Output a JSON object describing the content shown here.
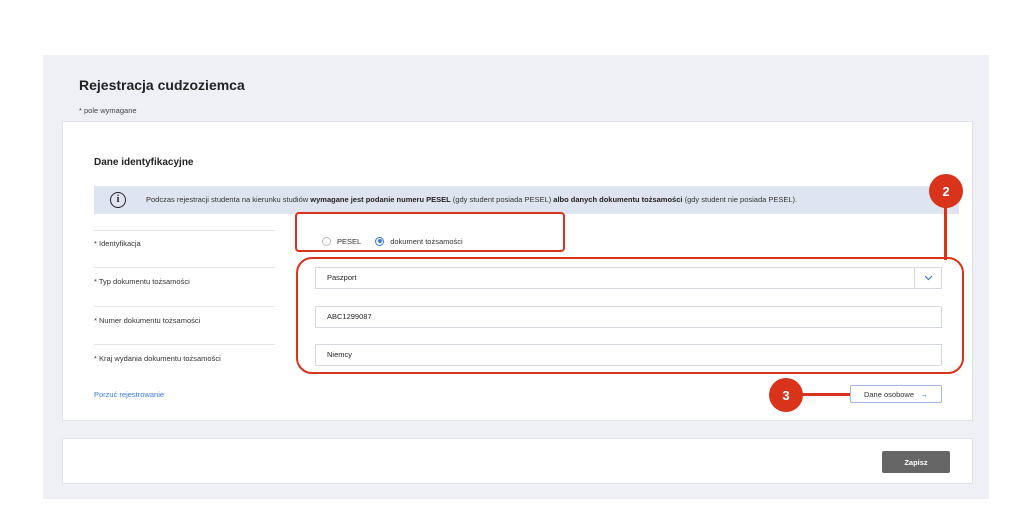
{
  "page": {
    "title": "Rejestracja cudzoziemca",
    "required_note": "* pole wymagane"
  },
  "section": {
    "title": "Dane identyfikacyjne",
    "info": {
      "icon": "info-icon",
      "text_1": "Podczas rejestracji studenta na kierunku studiów ",
      "bold_1": "wymagane jest podanie numeru PESEL",
      "text_2": " (gdy student posiada PESEL) ",
      "bold_2": "albo danych dokumentu tożsamości",
      "text_3": " (gdy student nie posiada PESEL)."
    }
  },
  "form": {
    "identification": {
      "label": "Identyfikacja",
      "options": [
        {
          "label": "PESEL",
          "selected": false
        },
        {
          "label": "dokument tożsamości",
          "selected": true
        }
      ]
    },
    "document_type": {
      "label": "Typ dokumentu tożsamości",
      "value": "Paszport"
    },
    "document_number": {
      "label": "Numer dokumentu tożsamości",
      "value": "ABC1299087"
    },
    "issuing_country": {
      "label": "Kraj wydania dokumentu tożsamości",
      "value": "Niemcy"
    }
  },
  "actions": {
    "abandon_label": "Porzuć rejestrowanie",
    "next_label": "Dane osobowe",
    "save_label": "Zapisz"
  },
  "annotations": {
    "badge_2": "2",
    "badge_3": "3",
    "color": "#d9331b"
  },
  "colors": {
    "accent": "#3c7ae0",
    "background": "#eef0f5",
    "info_bar": "#dfe5f0",
    "save_button": "#666666"
  }
}
